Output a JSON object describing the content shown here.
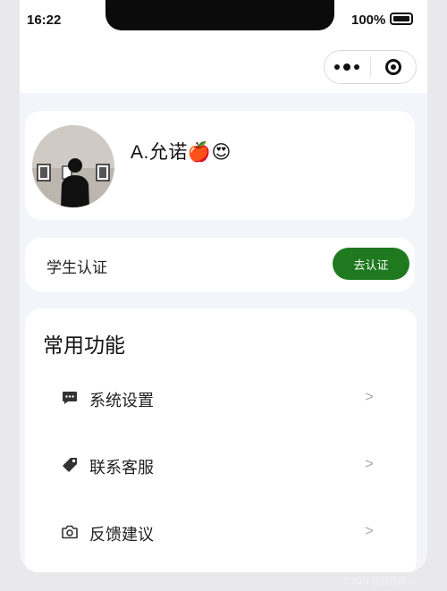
{
  "status_bar": {
    "time": "16:22",
    "battery_percent": "100%"
  },
  "mini_program_capsule": {
    "more_icon": "more-dots-icon",
    "close_icon": "target-circle-icon"
  },
  "profile": {
    "username": "A.允诺🍎😍",
    "avatar_icon": "avatar-photo"
  },
  "verification": {
    "label": "学生认证",
    "button_label": "去认证",
    "button_color": "#1f7a1f"
  },
  "functions": {
    "title": "常用功能",
    "items": [
      {
        "label": "系统设置",
        "icon": "chat-bubble-icon",
        "arrow": ">"
      },
      {
        "label": "联系客服",
        "icon": "tag-icon",
        "arrow": ">"
      },
      {
        "label": "反馈建议",
        "icon": "camera-icon",
        "arrow": ">"
      }
    ]
  },
  "watermark": "CSDN @程序媛..."
}
